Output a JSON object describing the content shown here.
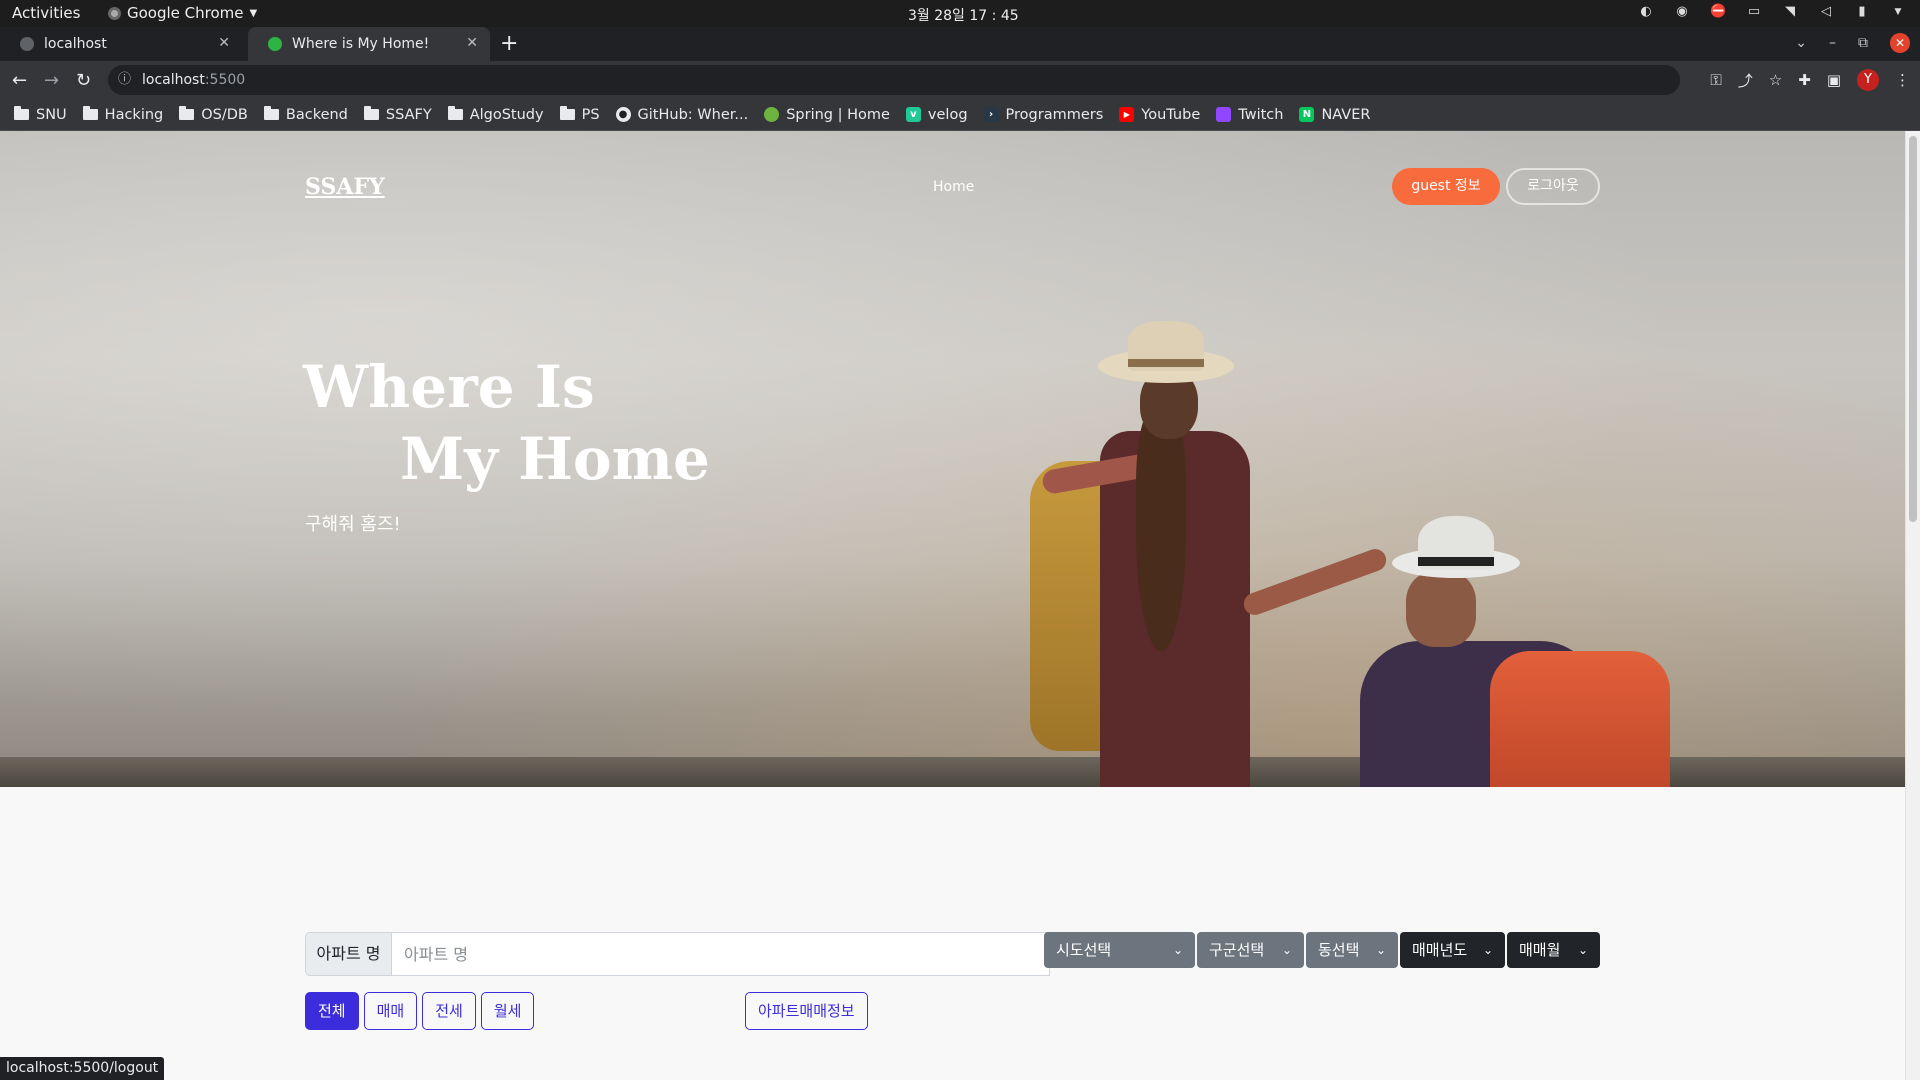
{
  "system": {
    "activities": "Activities",
    "app_name": "Google Chrome",
    "clock": "3월 28일  17 : 45"
  },
  "tabs": [
    {
      "title": "localhost",
      "active": false
    },
    {
      "title": "Where is My Home!",
      "active": true
    }
  ],
  "address": {
    "host": "localhost",
    "port": ":5500"
  },
  "bookmarks": [
    {
      "label": "SNU",
      "icon": "folder-icon"
    },
    {
      "label": "Hacking",
      "icon": "folder-icon"
    },
    {
      "label": "OS/DB",
      "icon": "folder-icon"
    },
    {
      "label": "Backend",
      "icon": "folder-icon"
    },
    {
      "label": "SSAFY",
      "icon": "folder-icon"
    },
    {
      "label": "AlgoStudy",
      "icon": "folder-icon"
    },
    {
      "label": "PS",
      "icon": "folder-icon"
    },
    {
      "label": "GitHub: Wher...",
      "icon": "github-icon"
    },
    {
      "label": "Spring | Home",
      "icon": "spring-icon"
    },
    {
      "label": "velog",
      "icon": "velog-icon"
    },
    {
      "label": "Programmers",
      "icon": "programmers-icon"
    },
    {
      "label": "YouTube",
      "icon": "youtube-icon"
    },
    {
      "label": "Twitch",
      "icon": "twitch-icon"
    },
    {
      "label": "NAVER",
      "icon": "naver-icon"
    }
  ],
  "site": {
    "brand": "SSAFY",
    "nav_home": "Home",
    "guest_button": "guest 정보",
    "logout_button": "로그아웃",
    "hero_line1": "Where Is",
    "hero_line2": "My Home",
    "tagline": "구해줘 홈즈!"
  },
  "search": {
    "label": "아파트 명",
    "placeholder": "아파트 명",
    "selects": [
      "시도선택",
      "구군선택",
      "동선택",
      "매매년도",
      "매매월"
    ],
    "filters": [
      "전체",
      "매매",
      "전세",
      "월세"
    ],
    "active_filter": "전체",
    "deal_info_button": "아파트매매정보"
  },
  "status_url": "localhost:5500/logout",
  "colors": {
    "accent": "#3b2ddb",
    "guest_button": "#f86b3c",
    "select_gray": "#6c757d",
    "select_dark": "#212529"
  }
}
